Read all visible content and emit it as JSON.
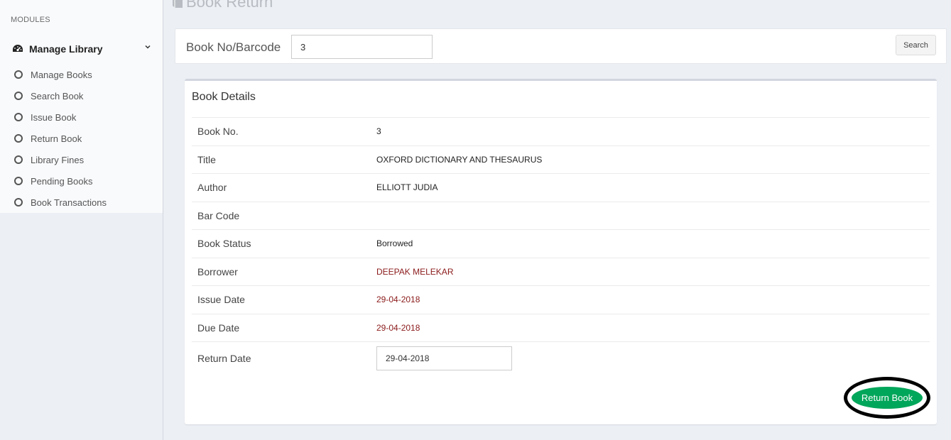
{
  "page": {
    "title": "Book Return"
  },
  "sidebar": {
    "header": "MODULES",
    "parent": {
      "label": "Manage Library",
      "icon": "dashboard-icon"
    },
    "items": [
      {
        "label": "Manage Books"
      },
      {
        "label": "Search Book"
      },
      {
        "label": "Issue Book"
      },
      {
        "label": "Return Book"
      },
      {
        "label": "Library Fines"
      },
      {
        "label": "Pending Books"
      },
      {
        "label": "Book Transactions"
      }
    ]
  },
  "search": {
    "label": "Book No/Barcode",
    "value": "3",
    "button": "Search"
  },
  "details": {
    "title": "Book Details",
    "rows": [
      {
        "key": "Book No.",
        "value": "3"
      },
      {
        "key": "Title",
        "value": "OXFORD DICTIONARY AND THESAURUS"
      },
      {
        "key": "Author",
        "value": "ELLIOTT JUDIA"
      },
      {
        "key": "Bar Code",
        "value": ""
      },
      {
        "key": "Book Status",
        "value": "Borrowed"
      },
      {
        "key": "Borrower",
        "value": "DEEPAK MELEKAR"
      },
      {
        "key": "Issue Date",
        "value": "29-04-2018"
      },
      {
        "key": "Due Date",
        "value": "29-04-2018"
      }
    ],
    "return_date": {
      "key": "Return Date",
      "value": "29-04-2018"
    },
    "return_button": "Return Book"
  },
  "colors": {
    "accent_green": "#00a65a",
    "highlight_red": "#8b1a1a",
    "background": "#ecf0f5"
  }
}
